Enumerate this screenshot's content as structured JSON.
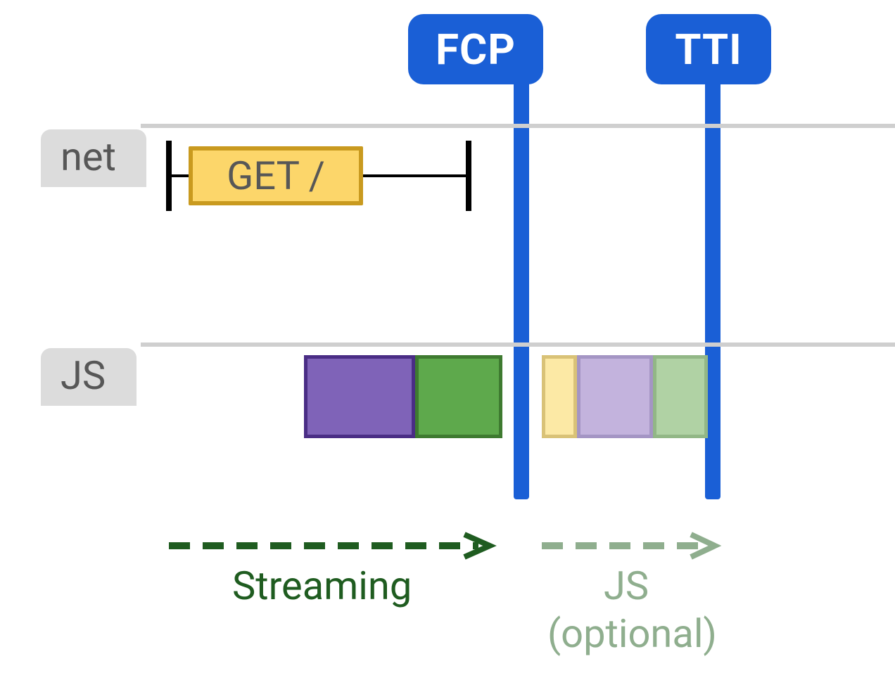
{
  "colors": {
    "blue": "#1a5fd6",
    "grayLine": "#cfcfcf",
    "grayLabelBg": "#dcdcdc",
    "grayText": "#575757",
    "yellowFill": "#fcd66a",
    "yellowBorder": "#c99a1f",
    "purpleFill": "#7f63b8",
    "purpleBorder": "#4a2d85",
    "greenFill": "#5ea94c",
    "greenBorder": "#3e7a30",
    "yellowLight": "#fce9a5",
    "yellowLightBorder": "#d9c277",
    "purpleLight": "#c3b3dd",
    "purpleLightBorder": "#a495c4",
    "greenLight": "#b0d2a4",
    "greenLightBorder": "#92b786",
    "darkGreen": "#1f5c20",
    "sage": "#8fae8e"
  },
  "markers": {
    "fcp": "FCP",
    "tti": "TTI"
  },
  "rows": {
    "net": "net",
    "js": "JS"
  },
  "net": {
    "requestLabel": "GET /"
  },
  "phases": {
    "streaming": "Streaming",
    "js": "JS",
    "jsOptional": "(optional)"
  },
  "chart_data": {
    "type": "timeline",
    "title": "Static rendering timeline with optional JS",
    "x_axis": "time (relative units, 0–100)",
    "markers": [
      {
        "name": "FCP",
        "x": 56
      },
      {
        "name": "TTI",
        "x": 80
      }
    ],
    "tracks": [
      {
        "name": "net",
        "spans": [
          {
            "label": "GET /",
            "start": 14,
            "request_end": 38,
            "response_end": 51,
            "color": "yellow"
          }
        ]
      },
      {
        "name": "JS",
        "blocks": [
          {
            "start": 30,
            "end": 44,
            "color": "purple",
            "faded": false
          },
          {
            "start": 44,
            "end": 54,
            "color": "green",
            "faded": false
          },
          {
            "start": 58,
            "end": 62,
            "color": "yellow",
            "faded": true
          },
          {
            "start": 62,
            "end": 72,
            "color": "purple",
            "faded": true
          },
          {
            "start": 72,
            "end": 79,
            "color": "green",
            "faded": true
          }
        ]
      }
    ],
    "phases": [
      {
        "label": "Streaming",
        "start": 14,
        "end": 54,
        "style": "solid-dark-green"
      },
      {
        "label": "JS (optional)",
        "start": 58,
        "end": 79,
        "style": "dashed-sage"
      }
    ]
  }
}
